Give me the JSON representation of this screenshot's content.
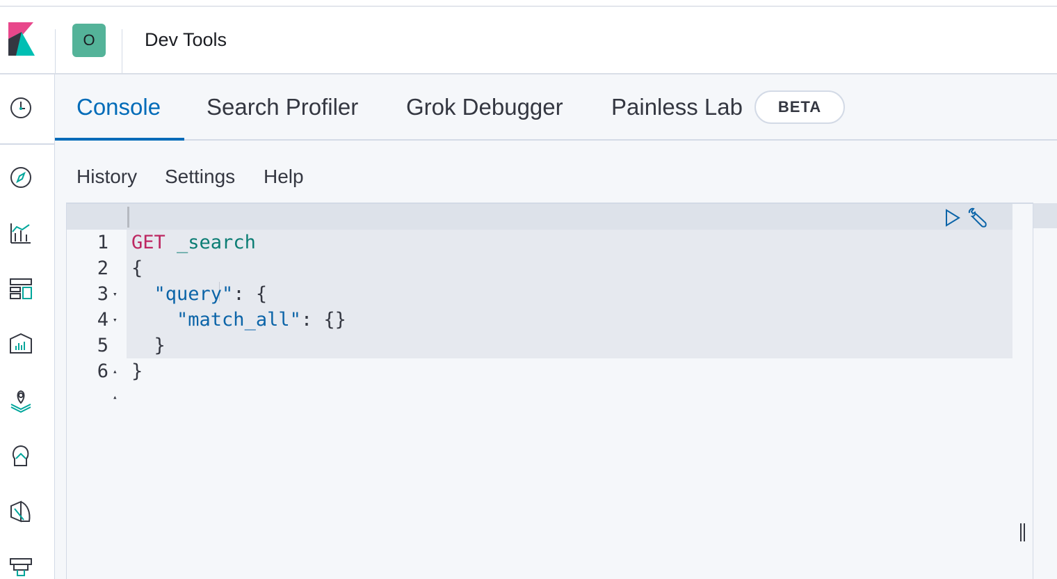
{
  "header": {
    "app_title": "Dev Tools",
    "space_initial": "O",
    "space_color": "#54b399"
  },
  "sidenav": {
    "items": [
      {
        "icon": "clock-icon"
      },
      {
        "icon": "compass-icon"
      },
      {
        "icon": "visualize-icon"
      },
      {
        "icon": "dashboard-icon"
      },
      {
        "icon": "canvas-icon"
      },
      {
        "icon": "maps-icon"
      },
      {
        "icon": "machine-learning-icon"
      },
      {
        "icon": "infrastructure-icon"
      },
      {
        "icon": "logs-icon"
      }
    ]
  },
  "tabs": [
    {
      "label": "Console",
      "active": true
    },
    {
      "label": "Search Profiler",
      "active": false
    },
    {
      "label": "Grok Debugger",
      "active": false
    },
    {
      "label": "Painless Lab",
      "active": false,
      "badge": "BETA"
    }
  ],
  "console_menu": {
    "history": "History",
    "settings": "Settings",
    "help": "Help"
  },
  "editor": {
    "lines": [
      {
        "number": "1",
        "method": "GET",
        "url": " _search"
      },
      {
        "number": "2",
        "text": "{"
      },
      {
        "number": "3",
        "key": "\"query\"",
        "rest": ": {"
      },
      {
        "number": "4",
        "key": "\"match_all\"",
        "rest": ": {}"
      },
      {
        "number": "5",
        "text": "  }"
      },
      {
        "number": "6",
        "text": "}"
      }
    ],
    "actions": [
      "play-icon",
      "wrench-icon"
    ]
  },
  "colors": {
    "accent": "#006bb8",
    "method": "#bd2761",
    "url": "#0c7d74",
    "key": "#0b64a8"
  }
}
